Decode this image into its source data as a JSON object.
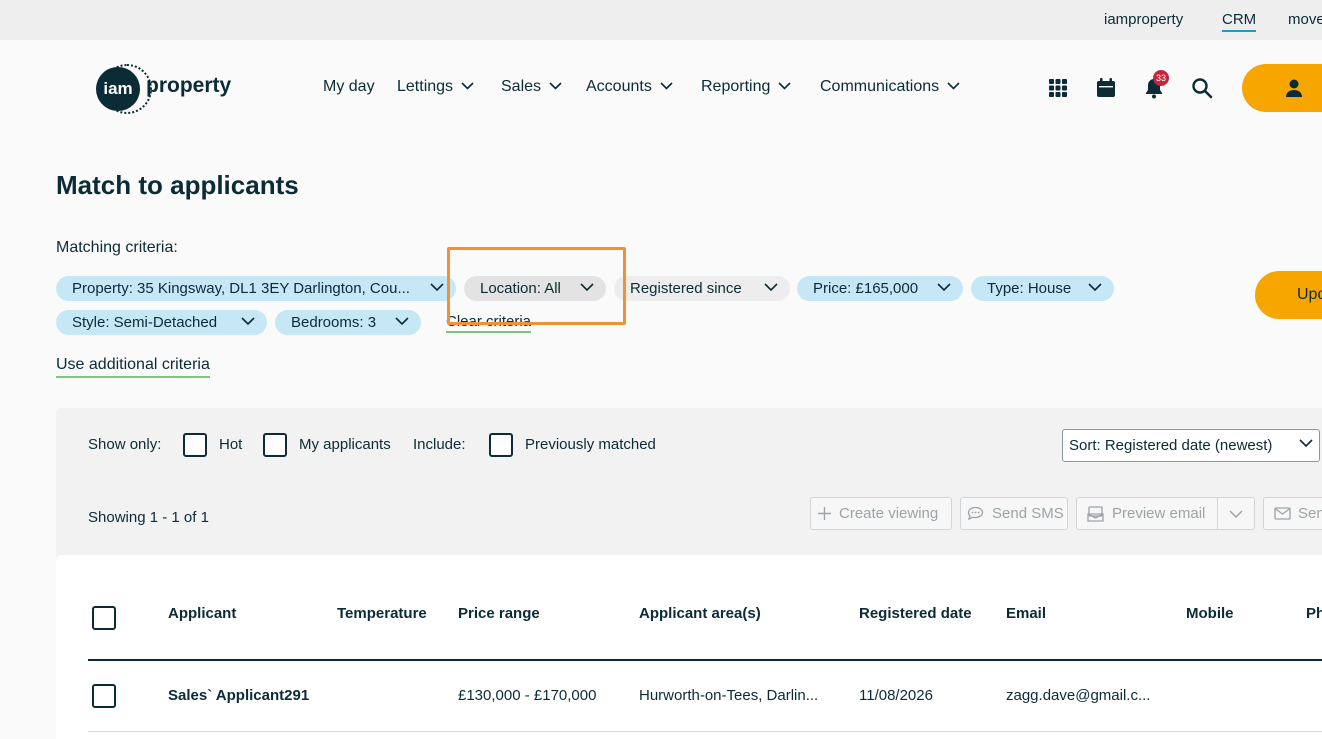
{
  "utility_bar": {
    "links": [
      "iamproperty",
      "CRM",
      "move"
    ]
  },
  "header": {
    "logo": {
      "mark": "iam",
      "word": "property"
    },
    "nav": [
      "My day",
      "Lettings",
      "Sales",
      "Accounts",
      "Reporting",
      "Communications"
    ],
    "icons": [
      "apps-grid-icon",
      "calendar-icon",
      "bell-icon",
      "search-icon",
      "user-icon"
    ],
    "notification_count": "33"
  },
  "page": {
    "title": "Match to applicants",
    "criteria_label": "Matching criteria:",
    "chips": [
      "Property: 35 Kingsway, DL1 3EY Darlington, Cou...",
      "Location: All",
      "Registered since",
      "Price: £165,000",
      "Type: House",
      "Style: Semi-Detached",
      "Bedrooms: 3"
    ],
    "clear_criteria": "Clear criteria",
    "additional_criteria": "Use additional criteria",
    "update_button": "Upd"
  },
  "filters": {
    "show_only": "Show only:",
    "hot": "Hot",
    "my_applicants": "My applicants",
    "include": "Include:",
    "previously_matched": "Previously matched",
    "sort": "Sort: Registered date (newest)"
  },
  "results": {
    "showing": "Showing 1 - 1 of 1",
    "actions": {
      "create_viewing": "Create viewing",
      "send_sms": "Send SMS",
      "preview_email": "Preview email",
      "send": "Sen"
    }
  },
  "table": {
    "columns": [
      "Applicant",
      "Temperature",
      "Price range",
      "Applicant area(s)",
      "Registered date",
      "Email",
      "Mobile",
      "Ph"
    ],
    "rows": [
      {
        "applicant": "Sales` Applicant291",
        "temperature": "",
        "price_range": "£130,000 - £170,000",
        "area": "Hurworth-on-Tees, Darlin...",
        "registered": "11/08/2026",
        "email": "zagg.dave@gmail.c...",
        "mobile": "",
        "phone": ""
      }
    ]
  },
  "colors": {
    "primary": "#0b2b36",
    "accent": "#f7a600",
    "chip": "#c6e8f6",
    "highlight": "#f0913a",
    "link_underline": "#7cc77c",
    "badge": "#c8253c"
  }
}
